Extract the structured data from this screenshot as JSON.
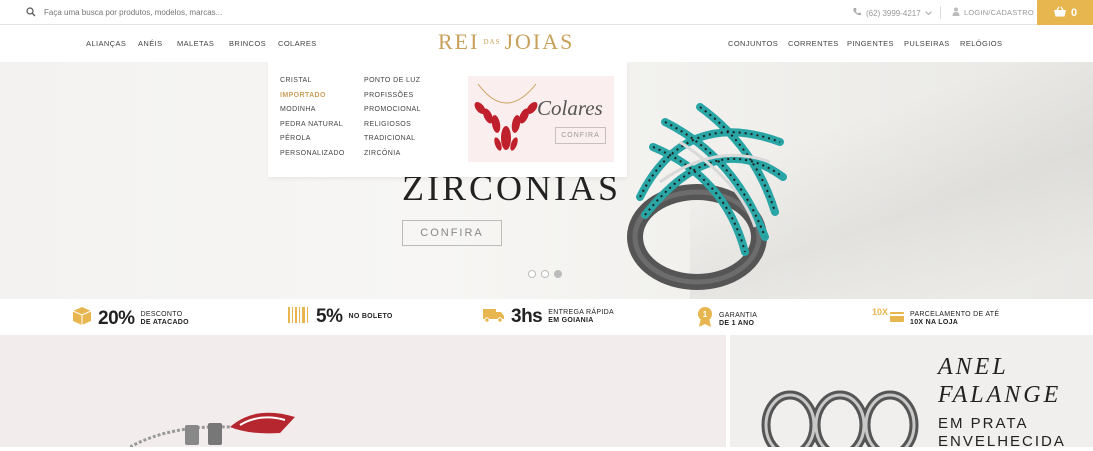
{
  "search": {
    "placeholder": "Faça uma busca por produtos, modelos, marcas..."
  },
  "header": {
    "phone": "(62) 3999-4217",
    "login": "LOGIN/CADASTRO",
    "cart_count": "0"
  },
  "logo": {
    "left": "REI",
    "middle": "DAS",
    "right": "JOIAS"
  },
  "nav": {
    "left": [
      "ALIANÇAS",
      "ANÉIS",
      "MALETAS",
      "BRINCOS",
      "COLARES"
    ],
    "right": [
      "CONJUNTOS",
      "CORRENTES",
      "PINGENTES",
      "PULSEIRAS",
      "RELÓGIOS"
    ]
  },
  "dropdown": {
    "col1": [
      "CRISTAL",
      "IMPORTADO",
      "MODINHA",
      "PEDRA NATURAL",
      "PÉROLA",
      "PERSONALIZADO"
    ],
    "col2": [
      "PONTO DE LUZ",
      "PROFISSÕES",
      "PROMOCIONAL",
      "RELIGIOSOS",
      "TRADICIONAL",
      "ZIRCÔNIA"
    ],
    "promo_title": "Colares",
    "promo_button": "CONFIRA"
  },
  "hero": {
    "title": "ZIRCÔNIAS",
    "button": "CONFIRA",
    "slides": 3,
    "active_slide": 3
  },
  "benefits": [
    {
      "big": "20%",
      "line1": "DESCONTO",
      "line2": "DE ATACADO"
    },
    {
      "big": "5%",
      "line1": "",
      "line2": "NO BOLETO"
    },
    {
      "big": "3hs",
      "line1": "ENTREGA RÁPIDA",
      "line2": "EM GOIANIA"
    },
    {
      "big": "",
      "line1": "GARANTIA",
      "line2": "DE 1 ANO"
    },
    {
      "big": "",
      "line1": "PARCELAMENTO DE ATÉ",
      "line2": "10X NA LOJA"
    }
  ],
  "benefit_badges": {
    "guarantee": "1",
    "installments": "10X"
  },
  "promo_right": {
    "line1": "ANEL",
    "line2": "FALANGE",
    "line3": "EM PRATA",
    "line4": "ENVELHECIDA"
  },
  "colors": {
    "accent": "#e8b64f",
    "gold": "#c9a05a",
    "turquoise": "#2aa5a5"
  }
}
